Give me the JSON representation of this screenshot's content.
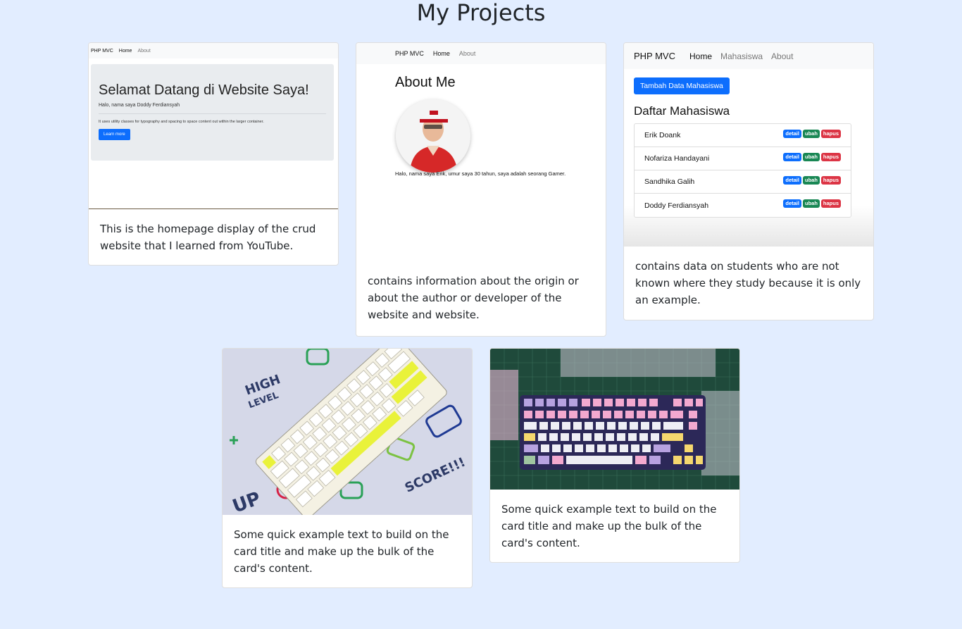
{
  "page": {
    "title": "My Projects"
  },
  "projects": [
    {
      "preview": {
        "brand": "PHP MVC",
        "nav": [
          "Home",
          "About"
        ],
        "heading": "Selamat Datang di Website Saya!",
        "lead": "Halo, nama saya Doddy Ferdiansyah",
        "text": "It uses utility classes for typography and spacing to space content out within the larger container.",
        "button": "Learn more"
      },
      "description": "This is the homepage display of the crud website that I learned from YouTube."
    },
    {
      "preview": {
        "brand": "PHP MVC",
        "nav": [
          "Home",
          "About"
        ],
        "heading": "About Me",
        "text": "Halo, nama saya Erik, umur saya 30 tahun, saya adalah seorang Gamer."
      },
      "description": "contains information about the origin or about the author or developer of the website and website."
    },
    {
      "preview": {
        "brand": "PHP MVC",
        "nav": [
          "Home",
          "Mahasiswa",
          "About"
        ],
        "button": "Tambah Data Mahasiswa",
        "heading": "Daftar Mahasiswa",
        "students": [
          "Erik Doank",
          "Nofariza Handayani",
          "Sandhika Galih",
          "Doddy Ferdiansyah"
        ],
        "badges": [
          "detail",
          "ubah",
          "hapus"
        ]
      },
      "description": "contains data on students who are not known where they study because it is only an example."
    },
    {
      "image": "keyboard-photo",
      "description": "Some quick example text to build on the card title and make up the bulk of the card's content."
    },
    {
      "image": "keyboard-photo",
      "description": "Some quick example text to build on the card title and make up the bulk of the card's content."
    }
  ],
  "colors": {
    "background": "#e2edff",
    "primary": "#0d6efd",
    "success": "#198754",
    "danger": "#dc3545"
  }
}
